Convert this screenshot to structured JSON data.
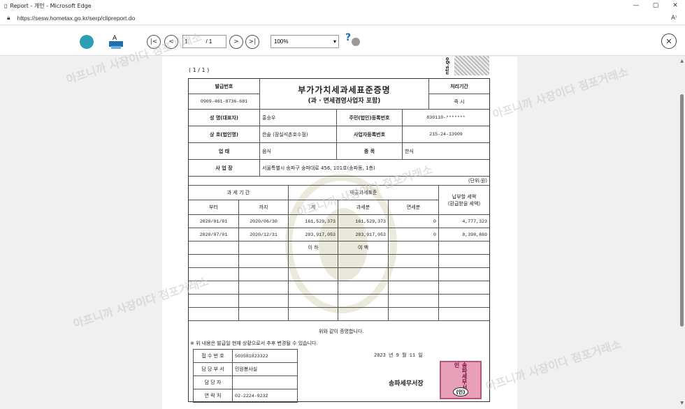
{
  "window": {
    "title": "Report - 개인 - Microsoft Edge",
    "url": "https://sesw.hometax.go.kr/serp/clipreport.do"
  },
  "toolbar": {
    "page_current": "1",
    "page_total": "/ 1",
    "zoom": "100%"
  },
  "document": {
    "page_indicator": "( 1 / 1 )",
    "nts_mark": "nts.go",
    "issue_no_label": "발급번호",
    "issue_no": "0909-461-8736-681",
    "title": "부가가치세과세표준증명",
    "subtitle": "(과 · 면세겸영사업자 포함)",
    "processing_label": "처리기간",
    "processing_value": "즉 시",
    "name_label": "성 명(대표자)",
    "name_value": "홍승우",
    "rrn_label": "주민(법인)등록번호",
    "rrn_value": "830110-*******",
    "company_label": "상 호(법인명)",
    "company_value": "한솥 (잠실석촌호수점)",
    "bizno_label": "사업자등록번호",
    "bizno_value": "215-24-13909",
    "business_label": "업 태",
    "business_value": "음식",
    "item_label": "종 목",
    "item_value": "한식",
    "address_label": "사 업 장",
    "address_value": "서울특별시 송파구 송파대로 456, 101호(송파동, 1층)",
    "unit": "(단위:원)",
    "col_period": "과 세 기 간",
    "col_sales_base": "매출과세표준",
    "col_tax": "납부할 세액",
    "col_tax_sub": "(환급받을 세액)",
    "col_from": "부터",
    "col_to": "까지",
    "col_total": "계",
    "col_taxable": "과세분",
    "col_exempt": "면세분",
    "rows": [
      {
        "from": "2020/01/01",
        "to": "2020/06/30",
        "total": "161,529,373",
        "taxable": "161,529,373",
        "exempt": "0",
        "tax": "4,777,323"
      },
      {
        "from": "2020/07/01",
        "to": "2020/12/31",
        "total": "283,917,053",
        "taxable": "283,917,053",
        "exempt": "0",
        "tax": "8,398,869"
      }
    ],
    "blank_mark_1": "이 하",
    "blank_mark_2": "여 백",
    "certify": "위와 같이 증명합니다.",
    "notice": "※ 위 내용은 발급일 현재 상황으로서 추후 변경될 수 있습니다.",
    "receipt_label": "접 수 번 호",
    "receipt_value": "503581823322",
    "dept_label": "담 당 부 서",
    "dept_value": "민원봉사실",
    "staff_label": "담 당 자",
    "staff_value": "",
    "contact_label": "연 락 처",
    "contact_value": "02-2224-9232",
    "issue_date": "2023 년 9 월 11 일",
    "office": "송파세무서장",
    "office_code": "(인)",
    "stamp_text": "송파세무서장인"
  },
  "watermarks": [
    "아프니까 사장이다 점포거래소",
    "아프니까 사장이다 점포거래소",
    "아프니까 사장이다 점포거래소",
    "아프니까 사장이다 점포거래소",
    "아프니까 사장이다 점포거래소"
  ]
}
